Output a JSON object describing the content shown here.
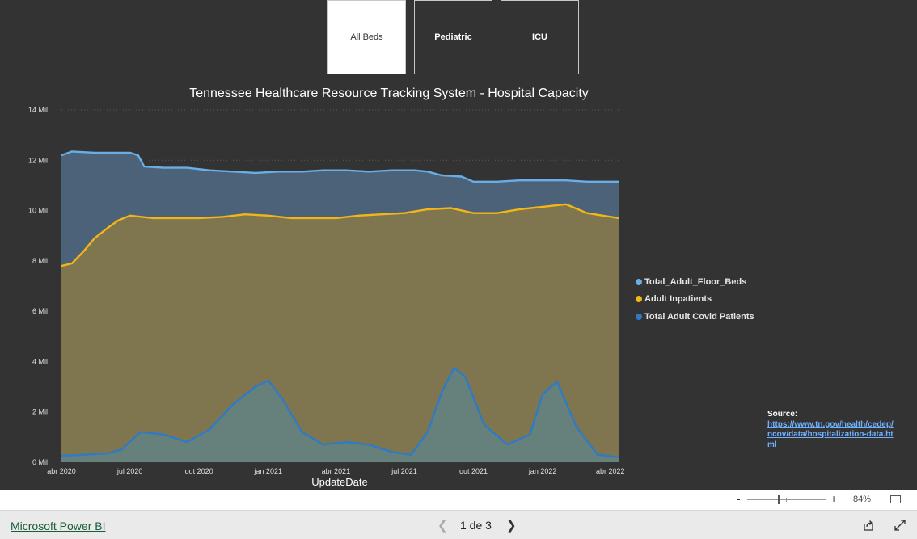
{
  "slicer": [
    {
      "label": "All Beds",
      "active": true
    },
    {
      "label": "Pediatric",
      "active": false
    },
    {
      "label": "ICU",
      "active": false
    }
  ],
  "chart_data": {
    "type": "area",
    "title": "Tennessee Healthcare Resource Tracking System - Hospital Capacity",
    "xlabel": "UpdateDate",
    "ylabel": "",
    "x_start": "2020-04-01",
    "x_end": "2022-04-12",
    "x_ticks": [
      "abr 2020",
      "jul 2020",
      "out 2020",
      "jan 2021",
      "abr 2021",
      "jul 2021",
      "out 2021",
      "jan 2022",
      "abr 2022"
    ],
    "y_ticks": [
      "0 Mil",
      "2 Mil",
      "4 Mil",
      "6 Mil",
      "8 Mil",
      "10 Mil",
      "12 Mil",
      "14 Mil"
    ],
    "ylim": [
      0,
      14000
    ],
    "legend_position": "right",
    "series": [
      {
        "name": "Total_Adult_Floor_Beds",
        "color": "#6aaee5",
        "fill": "#4c6279",
        "x": [
          "2020-04-01",
          "2020-04-15",
          "2020-05-15",
          "2020-06-15",
          "2020-07-01",
          "2020-07-12",
          "2020-07-20",
          "2020-08-15",
          "2020-09-15",
          "2020-10-15",
          "2020-11-15",
          "2020-12-15",
          "2021-01-15",
          "2021-02-15",
          "2021-03-15",
          "2021-04-15",
          "2021-05-15",
          "2021-06-15",
          "2021-07-15",
          "2021-08-01",
          "2021-08-20",
          "2021-09-15",
          "2021-10-01",
          "2021-11-01",
          "2021-12-01",
          "2022-01-01",
          "2022-02-01",
          "2022-03-01",
          "2022-04-12"
        ],
        "values": [
          12200,
          12350,
          12300,
          12300,
          12300,
          12200,
          11750,
          11700,
          11700,
          11600,
          11550,
          11500,
          11550,
          11550,
          11600,
          11600,
          11550,
          11600,
          11600,
          11550,
          11400,
          11350,
          11150,
          11150,
          11200,
          11200,
          11200,
          11150,
          11150
        ]
      },
      {
        "name": "Adult Inpatients",
        "color": "#f2b617",
        "fill": "#7f7650",
        "x": [
          "2020-04-01",
          "2020-04-15",
          "2020-05-01",
          "2020-05-15",
          "2020-06-01",
          "2020-06-15",
          "2020-07-01",
          "2020-08-01",
          "2020-09-01",
          "2020-10-01",
          "2020-11-01",
          "2020-12-01",
          "2021-01-01",
          "2021-02-01",
          "2021-03-01",
          "2021-04-01",
          "2021-05-01",
          "2021-06-01",
          "2021-07-01",
          "2021-08-01",
          "2021-09-01",
          "2021-10-01",
          "2021-11-01",
          "2021-12-01",
          "2022-01-01",
          "2022-02-01",
          "2022-03-01",
          "2022-04-12"
        ],
        "values": [
          7800,
          7900,
          8400,
          8900,
          9300,
          9600,
          9800,
          9700,
          9700,
          9700,
          9750,
          9850,
          9800,
          9700,
          9700,
          9700,
          9800,
          9850,
          9900,
          10050,
          10100,
          9900,
          9900,
          10050,
          10150,
          10250,
          9900,
          9700
        ]
      },
      {
        "name": "Total Adult Covid Patients",
        "color": "#2e7ac6",
        "fill": "#66807b",
        "x": [
          "2020-04-01",
          "2020-05-01",
          "2020-06-01",
          "2020-06-20",
          "2020-07-15",
          "2020-08-15",
          "2020-09-15",
          "2020-10-15",
          "2020-11-15",
          "2020-12-15",
          "2021-01-01",
          "2021-01-20",
          "2021-02-15",
          "2021-03-15",
          "2021-04-15",
          "2021-05-15",
          "2021-06-15",
          "2021-07-10",
          "2021-08-01",
          "2021-08-20",
          "2021-09-05",
          "2021-09-20",
          "2021-10-15",
          "2021-11-15",
          "2021-12-15",
          "2022-01-01",
          "2022-01-20",
          "2022-02-15",
          "2022-03-15",
          "2022-04-12"
        ],
        "values": [
          250,
          300,
          350,
          500,
          1200,
          1100,
          800,
          1300,
          2300,
          3000,
          3250,
          2500,
          1200,
          700,
          800,
          700,
          400,
          300,
          1200,
          2800,
          3750,
          3400,
          1500,
          700,
          1100,
          2700,
          3200,
          1400,
          300,
          200
        ]
      }
    ]
  },
  "source": {
    "label": "Source:",
    "link_text": "https://www.tn.gov/health/cedep/ncov/data/hospitalization-data.html"
  },
  "zoom": {
    "minus": "-",
    "plus": "+",
    "level": "84%"
  },
  "footer": {
    "brand": "Microsoft Power BI",
    "page": "1 de 3"
  },
  "icons": {
    "prev": "chevron-left-icon",
    "next": "chevron-right-icon",
    "share": "share-icon",
    "expand": "expand-icon",
    "fit": "fit-to-page-icon"
  }
}
